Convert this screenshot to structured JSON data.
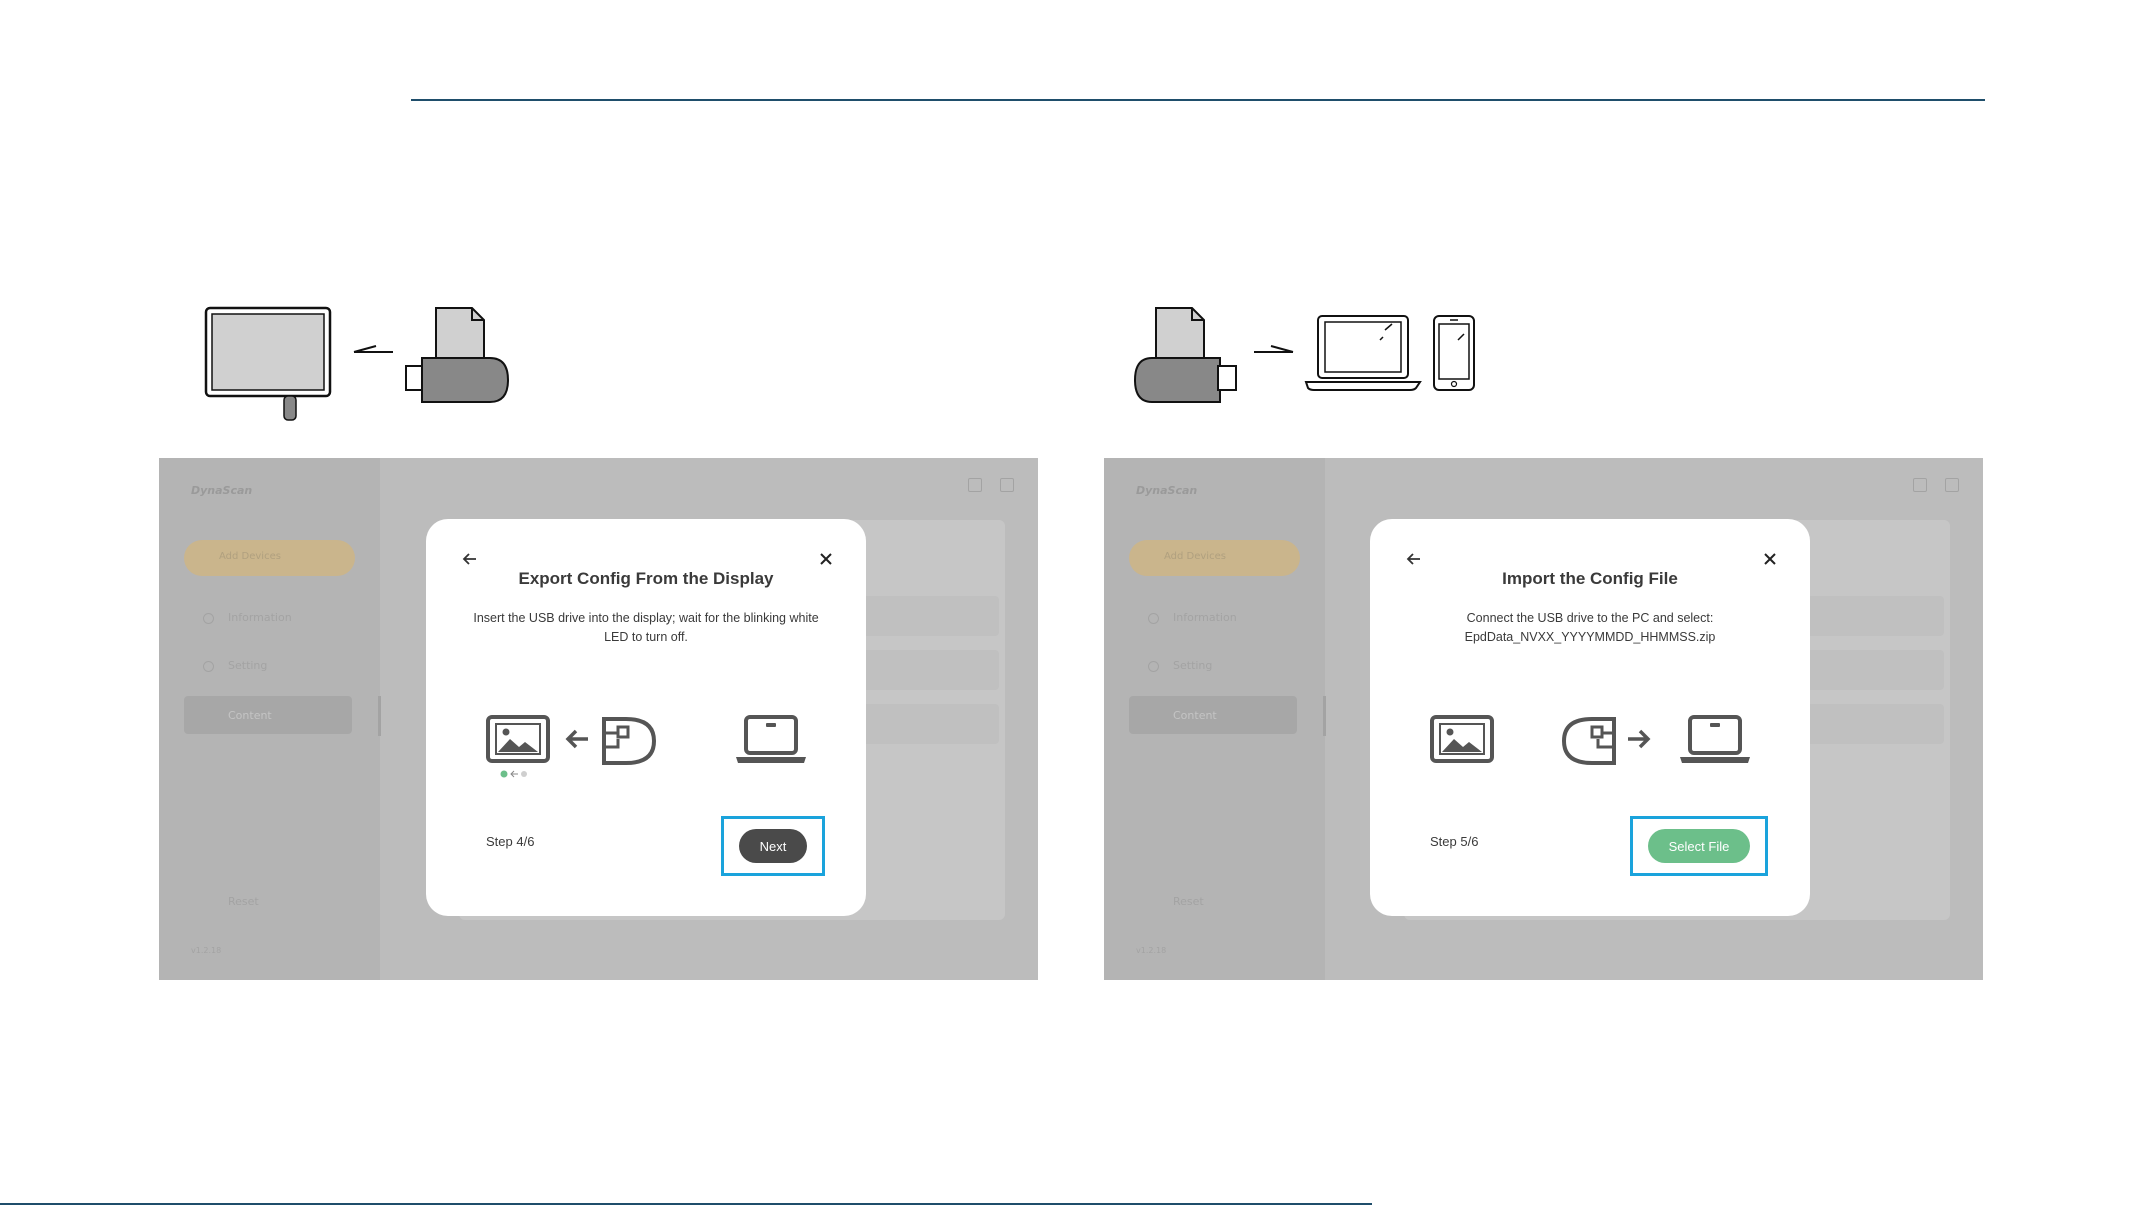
{
  "left_panel": {
    "brand": "DynaScan",
    "pill_label": "Add Devices",
    "nav": [
      "Information",
      "Setting",
      "Content"
    ],
    "reset": "Reset",
    "version": "v1.2.18",
    "modal": {
      "title": "Export Config From the Display",
      "description": "Insert the USB drive into the display; wait for the blinking white LED to turn off.",
      "step": "Step 4/6",
      "button_label": "Next",
      "button_color": "#4a4a4a"
    }
  },
  "right_panel": {
    "brand": "DynaScan",
    "pill_label": "Add Devices",
    "nav": [
      "Information",
      "Setting",
      "Content"
    ],
    "reset": "Reset",
    "version": "v1.2.18",
    "modal": {
      "title": "Import the Config File",
      "description_line1": "Connect the USB drive to the PC and select:",
      "description_line2": "EpdData_NVXX_YYYYMMDD_HHMMSS.zip",
      "step": "Step 5/6",
      "button_label": "Select File",
      "button_color": "#6cbf8a"
    }
  },
  "colors": {
    "rule": "#1f4e6b",
    "highlight": "#1aa3dc",
    "accent_green": "#6cbf8a"
  }
}
